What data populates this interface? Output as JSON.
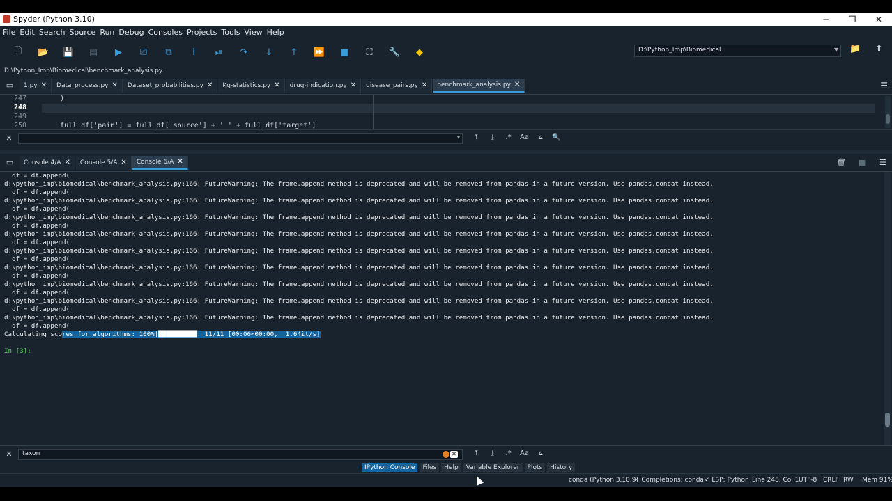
{
  "window": {
    "title": "Spyder (Python 3.10)"
  },
  "menu": [
    "File",
    "Edit",
    "Search",
    "Source",
    "Run",
    "Debug",
    "Consoles",
    "Projects",
    "Tools",
    "View",
    "Help"
  ],
  "toolbar": {
    "path": "D:\\Python_Imp\\Biomedical",
    "icons": [
      "new-file",
      "open-file",
      "save",
      "save-all",
      "run",
      "run-cell",
      "run-cell-advance",
      "run-selection",
      "debug",
      "step",
      "step-into",
      "step-return",
      "continue",
      "stop",
      "maximize-pane",
      "preferences",
      "python-path"
    ]
  },
  "editor": {
    "filepath": "D:\\Python_Imp\\Biomedical\\benchmark_analysis.py",
    "tabs": [
      "1.py",
      "Data_process.py",
      "Dataset_probabilities.py",
      "Kg-statistics.py",
      "drug-indication.py",
      "disease_pairs.py",
      "benchmark_analysis.py"
    ],
    "active_tab": 6,
    "lines": [
      {
        "num": "247",
        "text": "    )"
      },
      {
        "num": "248",
        "text": ""
      },
      {
        "num": "249",
        "text": ""
      },
      {
        "num": "250",
        "text": "    full_df['pair'] = full_df['source'] + ' ' + full_df['target']"
      }
    ],
    "find_text": ""
  },
  "console": {
    "tabs": [
      "Console 4/A",
      "Console 5/A",
      "Console 6/A"
    ],
    "active_tab": 2,
    "lines": [
      "  df = df.append(",
      "d:\\python_imp\\biomedical\\benchmark_analysis.py:166: FutureWarning: The frame.append method is deprecated and will be removed from pandas in a future version. Use pandas.concat instead.",
      "  df = df.append(",
      "d:\\python_imp\\biomedical\\benchmark_analysis.py:166: FutureWarning: The frame.append method is deprecated and will be removed from pandas in a future version. Use pandas.concat instead.",
      "  df = df.append(",
      "d:\\python_imp\\biomedical\\benchmark_analysis.py:166: FutureWarning: The frame.append method is deprecated and will be removed from pandas in a future version. Use pandas.concat instead.",
      "  df = df.append(",
      "d:\\python_imp\\biomedical\\benchmark_analysis.py:166: FutureWarning: The frame.append method is deprecated and will be removed from pandas in a future version. Use pandas.concat instead.",
      "  df = df.append(",
      "d:\\python_imp\\biomedical\\benchmark_analysis.py:166: FutureWarning: The frame.append method is deprecated and will be removed from pandas in a future version. Use pandas.concat instead.",
      "  df = df.append(",
      "d:\\python_imp\\biomedical\\benchmark_analysis.py:166: FutureWarning: The frame.append method is deprecated and will be removed from pandas in a future version. Use pandas.concat instead.",
      "  df = df.append(",
      "d:\\python_imp\\biomedical\\benchmark_analysis.py:166: FutureWarning: The frame.append method is deprecated and will be removed from pandas in a future version. Use pandas.concat instead.",
      "  df = df.append(",
      "d:\\python_imp\\biomedical\\benchmark_analysis.py:166: FutureWarning: The frame.append method is deprecated and will be removed from pandas in a future version. Use pandas.concat instead.",
      "  df = df.append(",
      "d:\\python_imp\\biomedical\\benchmark_analysis.py:166: FutureWarning: The frame.append method is deprecated and will be removed from pandas in a future version. Use pandas.concat instead.",
      "  df = df.append("
    ],
    "progress_pre": "Calculating sco",
    "progress_sel": "res for algorithms: 100%|██████████| 11/11 [00:06<00:00,  1.64it/s]",
    "prompt": "In [3]:",
    "find_text": "taxon"
  },
  "panel_tabs": [
    "IPython Console",
    "Files",
    "Help",
    "Variable Explorer",
    "Plots",
    "History"
  ],
  "panel_active": 0,
  "status": {
    "env": "conda (Python 3.10.9)",
    "completions": "✓ Completions: conda",
    "lsp": "✓ LSP: Python",
    "position": "Line 248, Col 1",
    "encoding": "UTF-8",
    "eol": "CRLF",
    "rw": "RW",
    "mem": "Mem 91%"
  }
}
